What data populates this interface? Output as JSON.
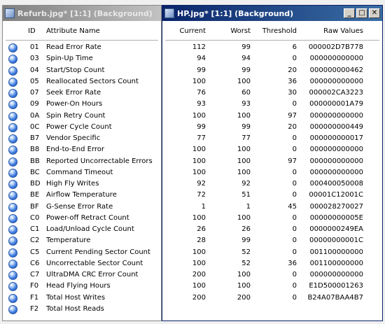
{
  "left_window": {
    "title": "Refurb.jpg* [1:1] (Background)",
    "columns": {
      "id": "ID",
      "name": "Attribute Name"
    }
  },
  "right_window": {
    "title": "HP.jpg* [1:1] (Background)",
    "buttons": {
      "minimize": "_",
      "maximize": "□",
      "close": "✕"
    },
    "columns": {
      "current": "Current",
      "worst": "Worst",
      "threshold": "Threshold",
      "raw": "Raw Values"
    }
  },
  "status_icon": "status-dot-icon",
  "rows": [
    {
      "id": "01",
      "name": "Read Error Rate",
      "current": "112",
      "worst": "99",
      "threshold": "6",
      "raw": "000002D7B778"
    },
    {
      "id": "03",
      "name": "Spin-Up Time",
      "current": "94",
      "worst": "94",
      "threshold": "0",
      "raw": "000000000000"
    },
    {
      "id": "04",
      "name": "Start/Stop Count",
      "current": "99",
      "worst": "99",
      "threshold": "20",
      "raw": "000000000462"
    },
    {
      "id": "05",
      "name": "Reallocated Sectors Count",
      "current": "100",
      "worst": "100",
      "threshold": "36",
      "raw": "000000000000"
    },
    {
      "id": "07",
      "name": "Seek Error Rate",
      "current": "76",
      "worst": "60",
      "threshold": "30",
      "raw": "000002CA3223"
    },
    {
      "id": "09",
      "name": "Power-On Hours",
      "current": "93",
      "worst": "93",
      "threshold": "0",
      "raw": "000000001A79"
    },
    {
      "id": "0A",
      "name": "Spin Retry Count",
      "current": "100",
      "worst": "100",
      "threshold": "97",
      "raw": "000000000000"
    },
    {
      "id": "0C",
      "name": "Power Cycle Count",
      "current": "99",
      "worst": "99",
      "threshold": "20",
      "raw": "000000000449"
    },
    {
      "id": "B7",
      "name": "Vendor Specific",
      "current": "77",
      "worst": "77",
      "threshold": "0",
      "raw": "000000000017"
    },
    {
      "id": "B8",
      "name": "End-to-End Error",
      "current": "100",
      "worst": "100",
      "threshold": "0",
      "raw": "000000000000"
    },
    {
      "id": "BB",
      "name": "Reported Uncorrectable Errors",
      "current": "100",
      "worst": "100",
      "threshold": "97",
      "raw": "000000000000"
    },
    {
      "id": "BC",
      "name": "Command Timeout",
      "current": "100",
      "worst": "100",
      "threshold": "0",
      "raw": "000000000000"
    },
    {
      "id": "BD",
      "name": "High Fly Writes",
      "current": "92",
      "worst": "92",
      "threshold": "0",
      "raw": "000400050008"
    },
    {
      "id": "BE",
      "name": "Airflow Temperature",
      "current": "72",
      "worst": "51",
      "threshold": "0",
      "raw": "00001C12001C"
    },
    {
      "id": "BF",
      "name": "G-Sense Error Rate",
      "current": "1",
      "worst": "1",
      "threshold": "45",
      "raw": "000028270027"
    },
    {
      "id": "C0",
      "name": "Power-off Retract Count",
      "current": "100",
      "worst": "100",
      "threshold": "0",
      "raw": "00000000005E"
    },
    {
      "id": "C1",
      "name": "Load/Unload Cycle Count",
      "current": "26",
      "worst": "26",
      "threshold": "0",
      "raw": "0000000249EA"
    },
    {
      "id": "C2",
      "name": "Temperature",
      "current": "28",
      "worst": "99",
      "threshold": "0",
      "raw": "00000000001C"
    },
    {
      "id": "C5",
      "name": "Current Pending Sector Count",
      "current": "100",
      "worst": "52",
      "threshold": "0",
      "raw": "001100000000"
    },
    {
      "id": "C6",
      "name": "Uncorrectable Sector Count",
      "current": "100",
      "worst": "52",
      "threshold": "36",
      "raw": "001100000000"
    },
    {
      "id": "C7",
      "name": "UltraDMA CRC Error Count",
      "current": "200",
      "worst": "100",
      "threshold": "0",
      "raw": "000000000000"
    },
    {
      "id": "F0",
      "name": "Head Flying Hours",
      "current": "100",
      "worst": "100",
      "threshold": "0",
      "raw": "E1D500001263"
    },
    {
      "id": "F1",
      "name": "Total Host Writes",
      "current": "200",
      "worst": "200",
      "threshold": "0",
      "raw": "B24A07BAA4B7"
    },
    {
      "id": "F2",
      "name": "Total Host Reads",
      "current": "",
      "worst": "",
      "threshold": "",
      "raw": ""
    }
  ]
}
